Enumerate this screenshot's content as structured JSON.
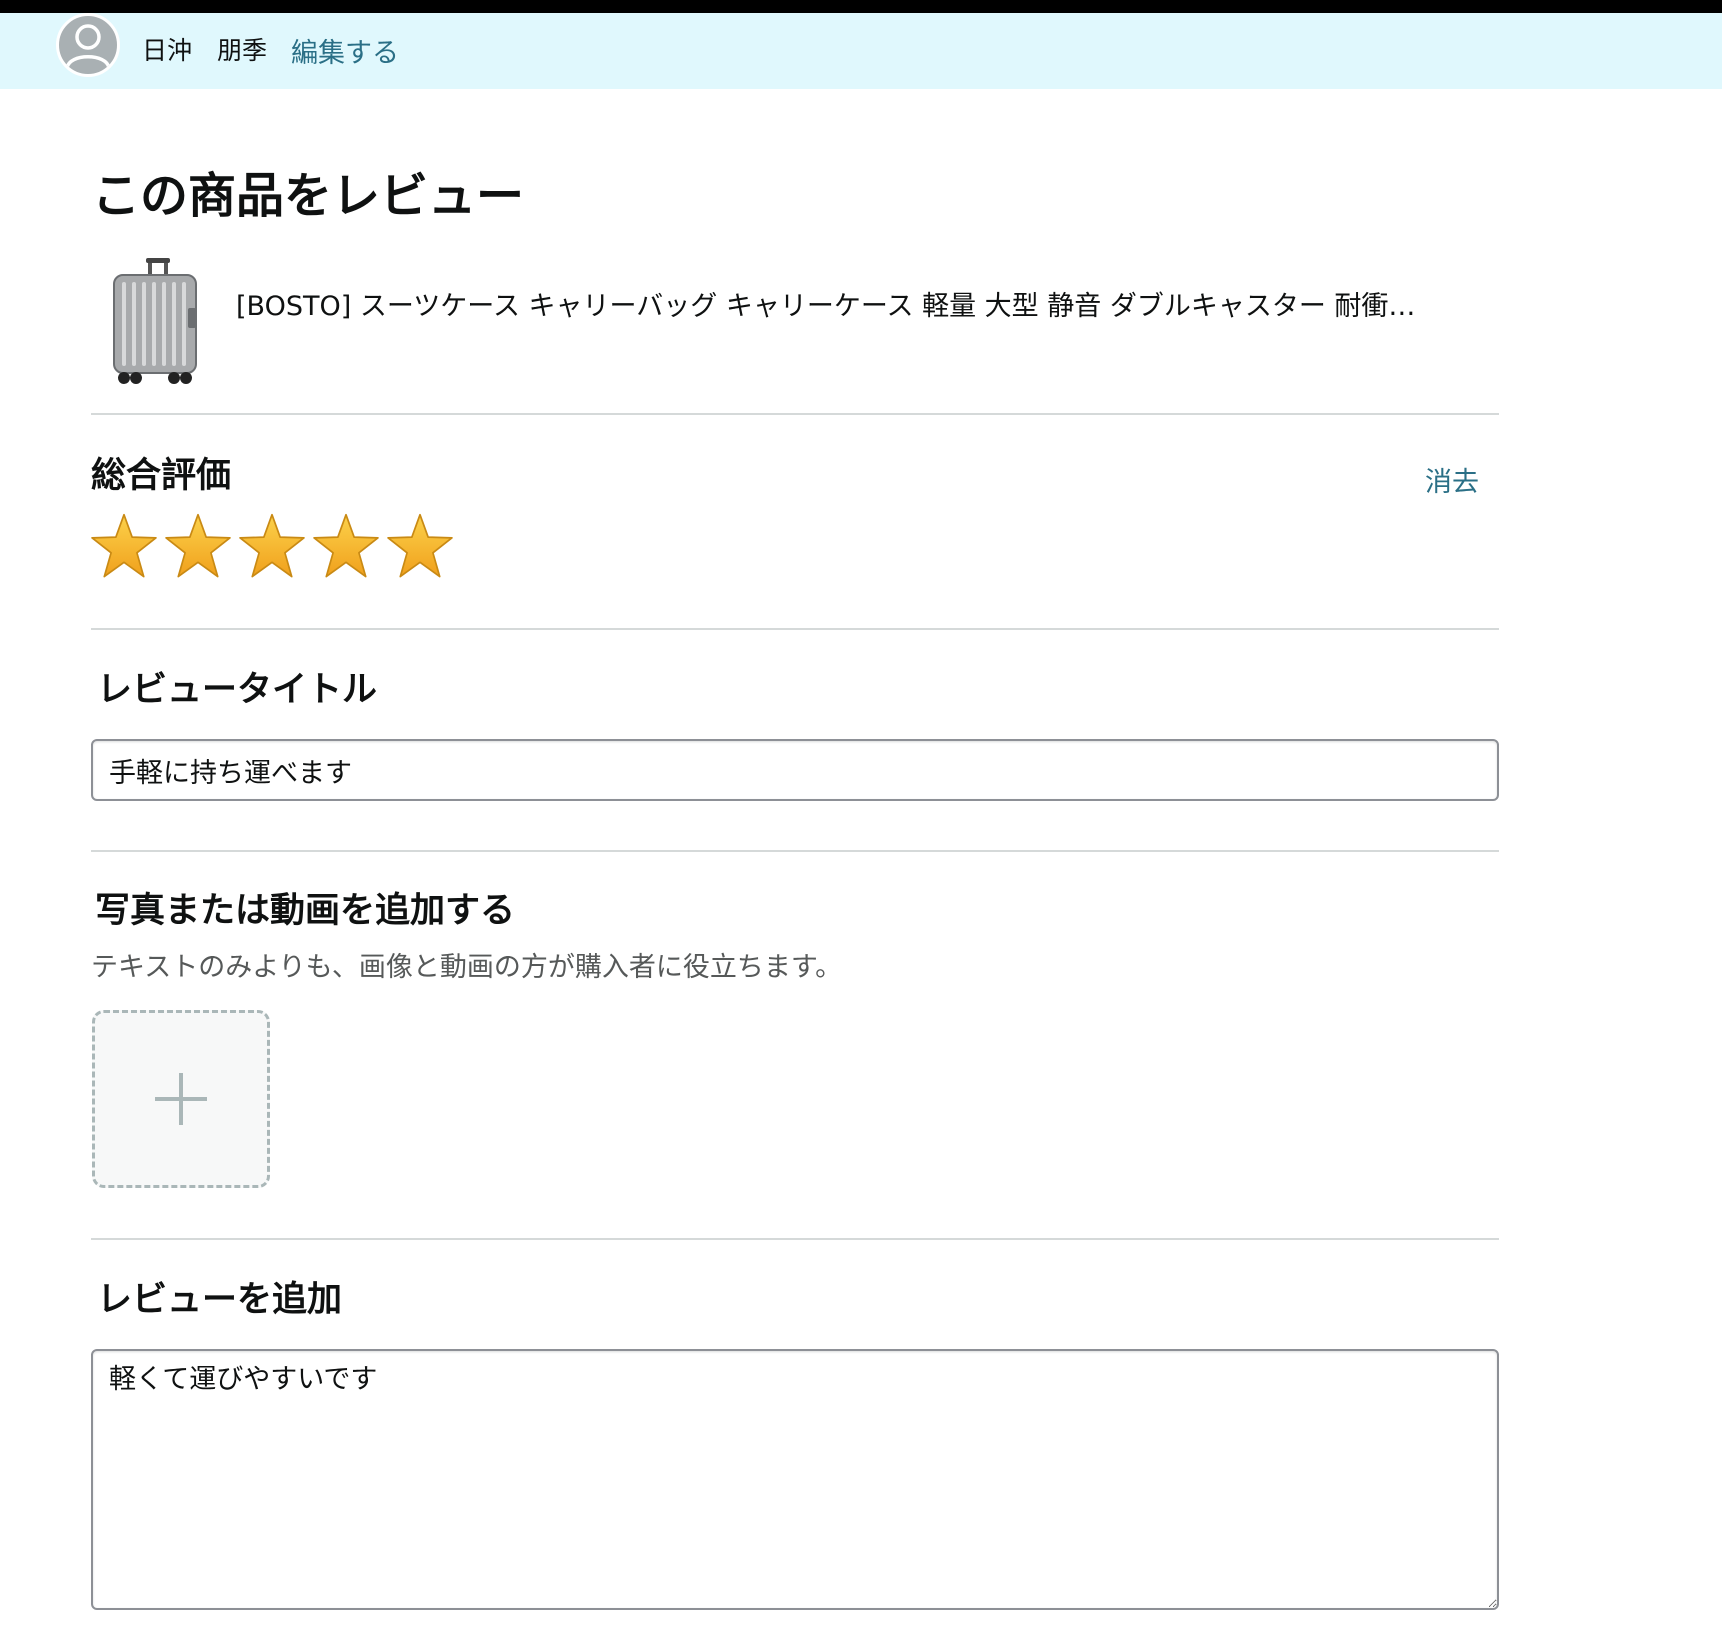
{
  "header": {
    "user_name": "日沖　朋季",
    "edit_label": "編集する"
  },
  "page": {
    "title": "この商品をレビュー"
  },
  "product": {
    "name": "[BOSTO] スーツケース キャリーバッグ キャリーケース 軽量 大型 静音 ダブルキャスター 耐衝…",
    "image_icon": "suitcase-image"
  },
  "overall_rating": {
    "heading": "総合評価",
    "clear_label": "消去",
    "rating": 5,
    "max_rating": 5,
    "star_color": "#f7b731"
  },
  "review_title": {
    "heading": "レビュータイトル",
    "value": "手軽に持ち運べます"
  },
  "media": {
    "heading": "写真または動画を追加する",
    "hint": "テキストのみよりも、画像と動画の方が購入者に役立ちます。",
    "upload_icon": "plus-icon"
  },
  "review_body": {
    "heading": "レビューを追加",
    "value": "軽くて運びやすいです"
  },
  "colors": {
    "header_background": "#e0f8fd",
    "link": "#2a6f86",
    "divider": "#d5d9d9"
  }
}
